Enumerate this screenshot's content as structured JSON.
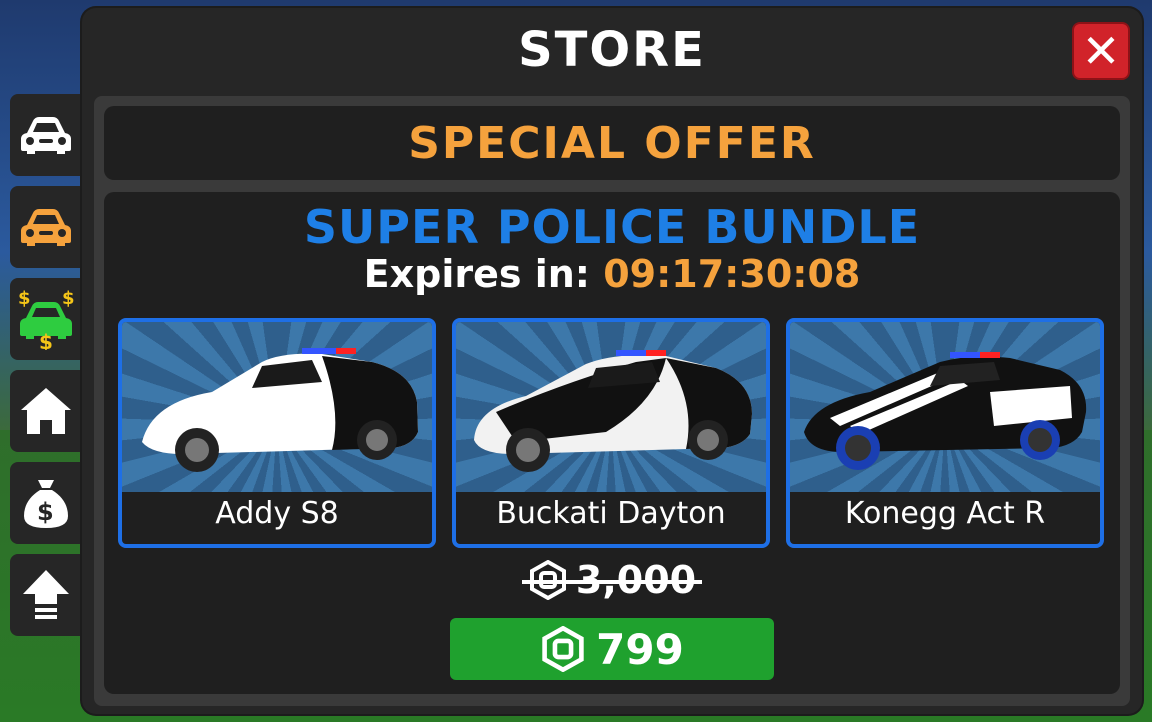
{
  "store": {
    "title": "STORE",
    "close_label": "✕"
  },
  "offer": {
    "banner_title": "SPECIAL OFFER",
    "bundle_title": "SUPER POLICE BUNDLE",
    "expires_label": "Expires in: ",
    "expires_time": "09:17:30:08"
  },
  "cars": [
    {
      "name": "Addy S8",
      "body_color": "#ffffff",
      "accent_color": "#111111"
    },
    {
      "name": "Buckati Dayton",
      "body_color": "#f2f2f2",
      "accent_color": "#111111"
    },
    {
      "name": "Konegg Act R",
      "body_color": "#111111",
      "accent_color": "#ffffff"
    }
  ],
  "pricing": {
    "original_price": "3,000",
    "sale_price": "799",
    "currency_icon": "robux-icon"
  },
  "side_nav": [
    {
      "icon": "car-white-icon",
      "color": "#ffffff"
    },
    {
      "icon": "car-orange-icon",
      "color": "#f5a23d"
    },
    {
      "icon": "car-money-icon",
      "color": "#2ecc40"
    },
    {
      "icon": "home-icon",
      "color": "#ffffff"
    },
    {
      "icon": "money-bag-icon",
      "color": "#ffffff"
    },
    {
      "icon": "upgrade-arrow-icon",
      "color": "#ffffff"
    }
  ],
  "colors": {
    "accent_orange": "#f5a23d",
    "bundle_blue": "#1e7fe6",
    "close_red": "#d1232a",
    "buy_green": "#1fa12e"
  }
}
